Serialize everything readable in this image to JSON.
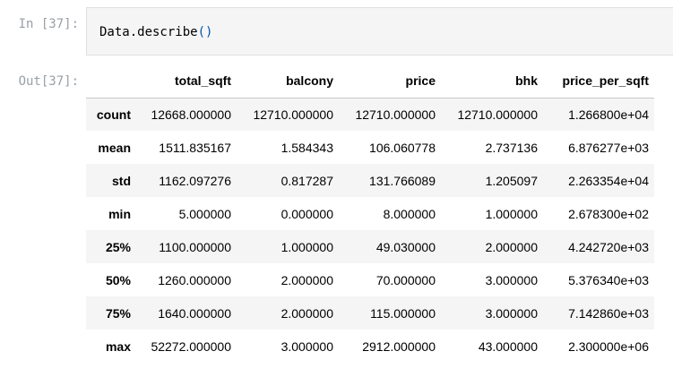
{
  "cell": {
    "in_prompt": "In [37]:",
    "out_prompt": "Out[37]:",
    "code_name": "Data.describe",
    "code_parens": "()"
  },
  "table": {
    "index_header": "",
    "columns": [
      "total_sqft",
      "balcony",
      "price",
      "bhk",
      "price_per_sqft"
    ],
    "rows": [
      {
        "label": "count",
        "values": [
          "12668.000000",
          "12710.000000",
          "12710.000000",
          "12710.000000",
          "1.266800e+04"
        ]
      },
      {
        "label": "mean",
        "values": [
          "1511.835167",
          "1.584343",
          "106.060778",
          "2.737136",
          "6.876277e+03"
        ]
      },
      {
        "label": "std",
        "values": [
          "1162.097276",
          "0.817287",
          "131.766089",
          "1.205097",
          "2.263354e+04"
        ]
      },
      {
        "label": "min",
        "values": [
          "5.000000",
          "0.000000",
          "8.000000",
          "1.000000",
          "2.678300e+02"
        ]
      },
      {
        "label": "25%",
        "values": [
          "1100.000000",
          "1.000000",
          "49.030000",
          "2.000000",
          "4.242720e+03"
        ]
      },
      {
        "label": "50%",
        "values": [
          "1260.000000",
          "2.000000",
          "70.000000",
          "3.000000",
          "5.376340e+03"
        ]
      },
      {
        "label": "75%",
        "values": [
          "1640.000000",
          "2.000000",
          "115.000000",
          "3.000000",
          "7.142860e+03"
        ]
      },
      {
        "label": "max",
        "values": [
          "52272.000000",
          "3.000000",
          "2912.000000",
          "43.000000",
          "2.300000e+06"
        ]
      }
    ]
  }
}
